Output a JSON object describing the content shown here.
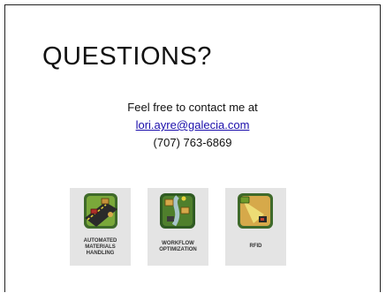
{
  "slide": {
    "title": "QUESTIONS?",
    "contact_intro": "Feel free to contact me at",
    "email": "lori.ayre@galecia.com",
    "phone": "(707) 763-6869"
  },
  "tiles": [
    {
      "icon": "automated-materials-handling-icon",
      "label_lines": [
        "AUTOMATED",
        "MATERIALS",
        "HANDLING"
      ]
    },
    {
      "icon": "workflow-optimization-icon",
      "label_lines": [
        "WORKFLOW",
        "OPTIMIZATION"
      ]
    },
    {
      "icon": "rfid-icon",
      "label_lines": [
        "RFID"
      ]
    }
  ],
  "colors": {
    "link": "#1a0dab",
    "tile_background": "#e4e4e4",
    "icon_green": "#6f9a2a",
    "icon_tan": "#d6a94a"
  }
}
